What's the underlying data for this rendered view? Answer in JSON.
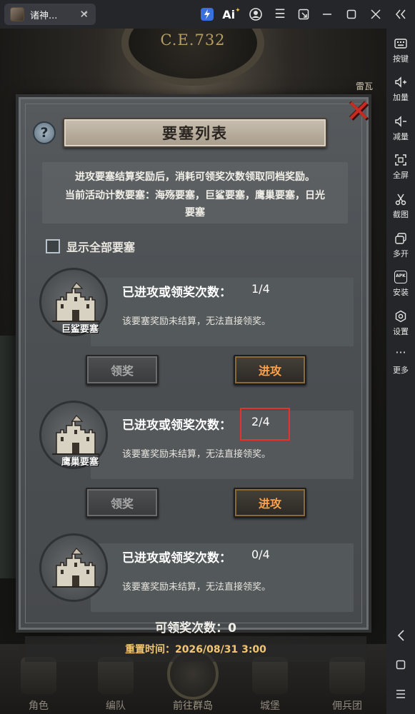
{
  "window": {
    "tab_title": "诸神...",
    "tab_close": "✕",
    "toolbar_icons": [
      "bolt-icon",
      "ai-icon",
      "account-icon",
      "menu-icon",
      "screen-switch-icon",
      "minimize-icon",
      "maximize-icon",
      "close-icon",
      "collapse-icon"
    ],
    "ai_label": "Ai"
  },
  "sidebar": {
    "items": [
      {
        "label": "按键",
        "icon": "keyboard-icon"
      },
      {
        "label": "加量",
        "icon": "volume-up-icon"
      },
      {
        "label": "减量",
        "icon": "volume-down-icon"
      },
      {
        "label": "全屏",
        "icon": "fullscreen-icon"
      },
      {
        "label": "截图",
        "icon": "screenshot-icon"
      },
      {
        "label": "多开",
        "icon": "multi-instance-icon"
      },
      {
        "label": "安装",
        "icon": "install-apk-icon"
      },
      {
        "label": "设置",
        "icon": "settings-icon"
      },
      {
        "label": "更多",
        "icon": "more-icon"
      }
    ],
    "apk_text": "APK",
    "nav": [
      "back-icon",
      "home-icon",
      "recents-icon"
    ]
  },
  "game": {
    "era": "C.E.732",
    "top_right_label": "雷瓦",
    "bottom_nav": [
      {
        "label": "角色"
      },
      {
        "label": "编队"
      },
      {
        "label": "前往群岛"
      },
      {
        "label": "城堡"
      },
      {
        "label": "佣兵团"
      }
    ]
  },
  "modal": {
    "title": "要塞列表",
    "help_glyph": "?",
    "close_glyph": "✕",
    "description": [
      "进攻要塞结算奖励后，消耗可领奖次数领取同档奖励。",
      "当前活动计数要塞：海殇要塞，巨鲨要塞，鹰巢要塞，日光",
      "要塞"
    ],
    "show_all_label": "显示全部要塞",
    "show_all_checked": false,
    "fortresses": [
      {
        "name": "巨鲨要塞",
        "count_label": "已进攻或领奖次数：",
        "count": "1/4",
        "note": "该要塞奖励未结算，无法直接领奖。",
        "claim_label": "领奖",
        "attack_label": "进攻",
        "highlighted": false
      },
      {
        "name": "鹰巢要塞",
        "count_label": "已进攻或领奖次数：",
        "count": "2/4",
        "note": "该要塞奖励未结算，无法直接领奖。",
        "claim_label": "领奖",
        "attack_label": "进攻",
        "highlighted": true
      },
      {
        "name": "",
        "count_label": "已进攻或领奖次数：",
        "count": "0/4",
        "note": "该要塞奖励未结算，无法直接领奖。",
        "claim_label": "领奖",
        "attack_label": "进攻",
        "highlighted": false
      }
    ],
    "remaining_claims": "可领奖次数：0",
    "reset_time": "重置时间：2026/08/31 3:00"
  },
  "colors": {
    "attack_text": "#ffa24a",
    "highlight": "#e4322d",
    "close_x": "#c92a22",
    "reset_text": "#f0c674"
  }
}
